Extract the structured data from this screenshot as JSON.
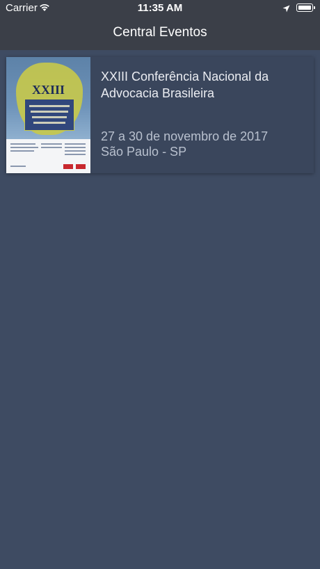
{
  "status_bar": {
    "carrier": "Carrier",
    "time": "11:35 AM"
  },
  "nav": {
    "title": "Central Eventos"
  },
  "events": [
    {
      "title": "XXIII Conferência Nacional da Advocacia Brasileira",
      "date": "27 a 30 de novembro de 2017",
      "location": "São Paulo - SP",
      "poster_heading": "XXIII"
    }
  ],
  "colors": {
    "background": "#3e4b62",
    "nav_bar": "#3b3f48",
    "card": "#3a465c",
    "title_text": "#ebedf2",
    "secondary_text": "#b8c0ce"
  },
  "icons": [
    "wifi-icon",
    "location-arrow-icon",
    "battery-icon"
  ]
}
